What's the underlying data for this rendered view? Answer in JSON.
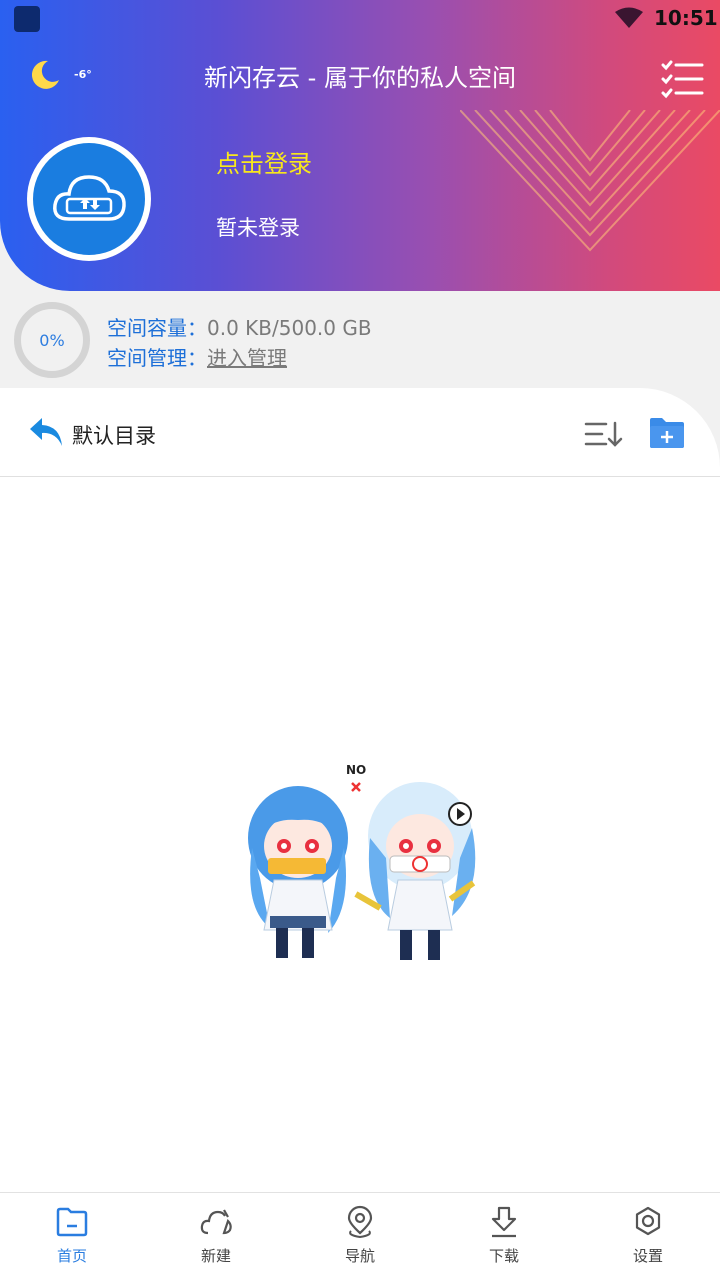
{
  "status_bar": {
    "time": "10:51"
  },
  "header": {
    "temperature": "-6°",
    "title": "新闪存云 - 属于你的私人空间",
    "login_link": "点击登录",
    "login_status": "暂未登录"
  },
  "capacity": {
    "percent": "0%",
    "capacity_label": "空间容量：",
    "capacity_value": "0.0 KB/500.0 GB",
    "manage_label": "空间管理：",
    "manage_link": "进入管理"
  },
  "directory": {
    "title": "默认目录"
  },
  "illustration": {
    "caption": "NO"
  },
  "bottom_nav": [
    {
      "label": "首页",
      "icon": "folder-icon",
      "active": true
    },
    {
      "label": "新建",
      "icon": "cloud-icon"
    },
    {
      "label": "导航",
      "icon": "location-icon"
    },
    {
      "label": "下载",
      "icon": "download-icon"
    },
    {
      "label": "设置",
      "icon": "settings-icon"
    }
  ],
  "colors": {
    "accent": "#2a7de0",
    "login_link": "#f8e71c",
    "gradient_start": "#2a60f0",
    "gradient_end": "#ea4a64"
  }
}
